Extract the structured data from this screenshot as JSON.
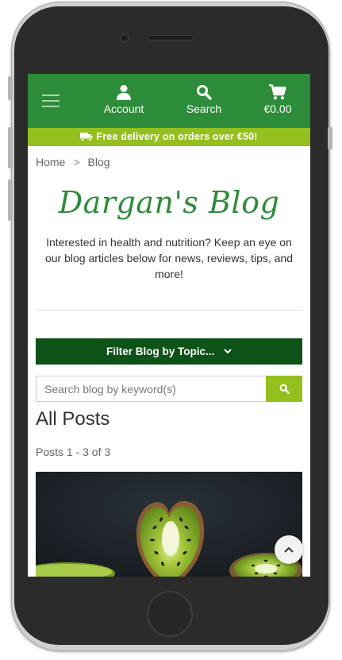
{
  "header": {
    "account_label": "Account",
    "search_label": "Search",
    "cart_total": "€0.00"
  },
  "promo": {
    "text": "Free delivery on orders over €50!"
  },
  "breadcrumb": {
    "home": "Home",
    "separator": ">",
    "current": "Blog"
  },
  "blog": {
    "title": "Dargan's Blog",
    "intro": "Interested in health and nutrition? Keep an eye on our blog articles below for news, reviews, tips, and more!",
    "filter_label": "Filter Blog by Topic...",
    "search_placeholder": "Search blog by keyword(s)",
    "all_posts_heading": "All Posts",
    "posts_count": "Posts 1 - 3 of 3"
  },
  "colors": {
    "header_green": "#2d8c3a",
    "promo_lime": "#93c01f",
    "filter_dark_green": "#0d5217"
  },
  "icons": {
    "menu": "hamburger-icon",
    "account": "user-icon",
    "search": "search-icon",
    "cart": "cart-icon",
    "delivery": "truck-icon",
    "filter": "chevron-down-icon",
    "scroll_top": "chevron-up-icon"
  }
}
